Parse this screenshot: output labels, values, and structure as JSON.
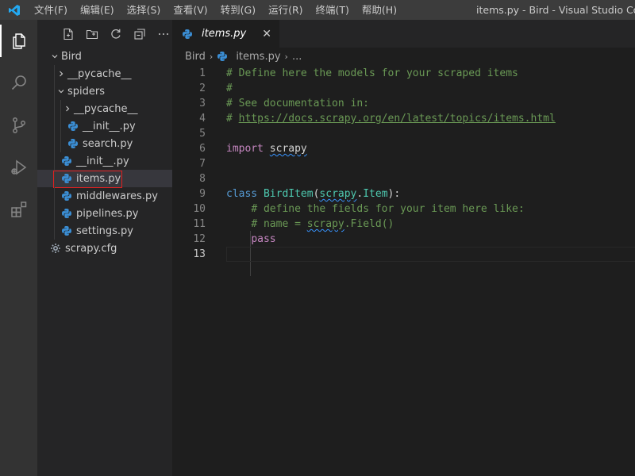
{
  "titlebar": {
    "menu": [
      "文件(F)",
      "编辑(E)",
      "选择(S)",
      "查看(V)",
      "转到(G)",
      "运行(R)",
      "终端(T)",
      "帮助(H)"
    ],
    "window_title": "items.py - Bird - Visual Studio Code [管"
  },
  "activity_icons": [
    "explorer-icon",
    "search-icon",
    "source-control-icon",
    "run-debug-icon",
    "extensions-icon"
  ],
  "sidebar": {
    "toolbar_icons": [
      "new-file-icon",
      "new-folder-icon",
      "refresh-icon",
      "collapse-all-icon"
    ],
    "tree": [
      {
        "label": "Bird",
        "type": "folder",
        "expanded": true,
        "depth": 0
      },
      {
        "label": "__pycache__",
        "type": "folder",
        "expanded": false,
        "depth": 1
      },
      {
        "label": "spiders",
        "type": "folder",
        "expanded": true,
        "depth": 1
      },
      {
        "label": "__pycache__",
        "type": "folder",
        "expanded": false,
        "depth": 2
      },
      {
        "label": "__init__.py",
        "type": "python",
        "depth": 2
      },
      {
        "label": "search.py",
        "type": "python",
        "depth": 2
      },
      {
        "label": "__init__.py",
        "type": "python",
        "depth": 1
      },
      {
        "label": "items.py",
        "type": "python",
        "depth": 1,
        "selected": true
      },
      {
        "label": "middlewares.py",
        "type": "python",
        "depth": 1
      },
      {
        "label": "pipelines.py",
        "type": "python",
        "depth": 1
      },
      {
        "label": "settings.py",
        "type": "python",
        "depth": 1
      },
      {
        "label": "scrapy.cfg",
        "type": "config",
        "depth": 0
      }
    ]
  },
  "editor": {
    "tab": {
      "label": "items.py",
      "close": "✕"
    },
    "breadcrumb": {
      "folder": "Bird",
      "file": "items.py",
      "more": "..."
    },
    "lines": [
      {
        "n": "1",
        "t": [
          [
            "c",
            "# Define here the models for your scraped items"
          ]
        ]
      },
      {
        "n": "2",
        "t": [
          [
            "c",
            "#"
          ]
        ]
      },
      {
        "n": "3",
        "t": [
          [
            "c",
            "# See documentation in:"
          ]
        ]
      },
      {
        "n": "4",
        "t": [
          [
            "c",
            "# "
          ],
          [
            "link",
            "https://docs.scrapy.org/en/latest/topics/items.html"
          ]
        ]
      },
      {
        "n": "5",
        "t": []
      },
      {
        "n": "6",
        "t": [
          [
            "kw2",
            "import"
          ],
          [
            "txt",
            " "
          ],
          [
            "txt squig",
            "scrapy"
          ]
        ]
      },
      {
        "n": "7",
        "t": []
      },
      {
        "n": "8",
        "t": []
      },
      {
        "n": "9",
        "t": [
          [
            "kw",
            "class"
          ],
          [
            "txt",
            " "
          ],
          [
            "cls",
            "BirdItem"
          ],
          [
            "txt",
            "("
          ],
          [
            "cls squig",
            "scrapy"
          ],
          [
            "txt",
            "."
          ],
          [
            "cls",
            "Item"
          ],
          [
            "txt",
            "):"
          ]
        ]
      },
      {
        "n": "10",
        "t": [
          [
            "txt",
            "    "
          ],
          [
            "c",
            "# define the fields for your item here like:"
          ]
        ]
      },
      {
        "n": "11",
        "t": [
          [
            "txt",
            "    "
          ],
          [
            "c",
            "# name = "
          ],
          [
            "c squig",
            "scrapy"
          ],
          [
            "c",
            ".Field()"
          ]
        ]
      },
      {
        "n": "12",
        "t": [
          [
            "txt",
            "    "
          ],
          [
            "kw2",
            "pass"
          ]
        ]
      },
      {
        "n": "13",
        "t": [],
        "current": true
      }
    ]
  },
  "colors": {
    "comment": "#6a9955",
    "keyword": "#569cd6",
    "control_keyword": "#c586c0",
    "class_name": "#4ec9b0",
    "python_icon": "#3b8fd6",
    "vscode_logo": "#23a9f2",
    "selection_outline": "#e02020"
  }
}
